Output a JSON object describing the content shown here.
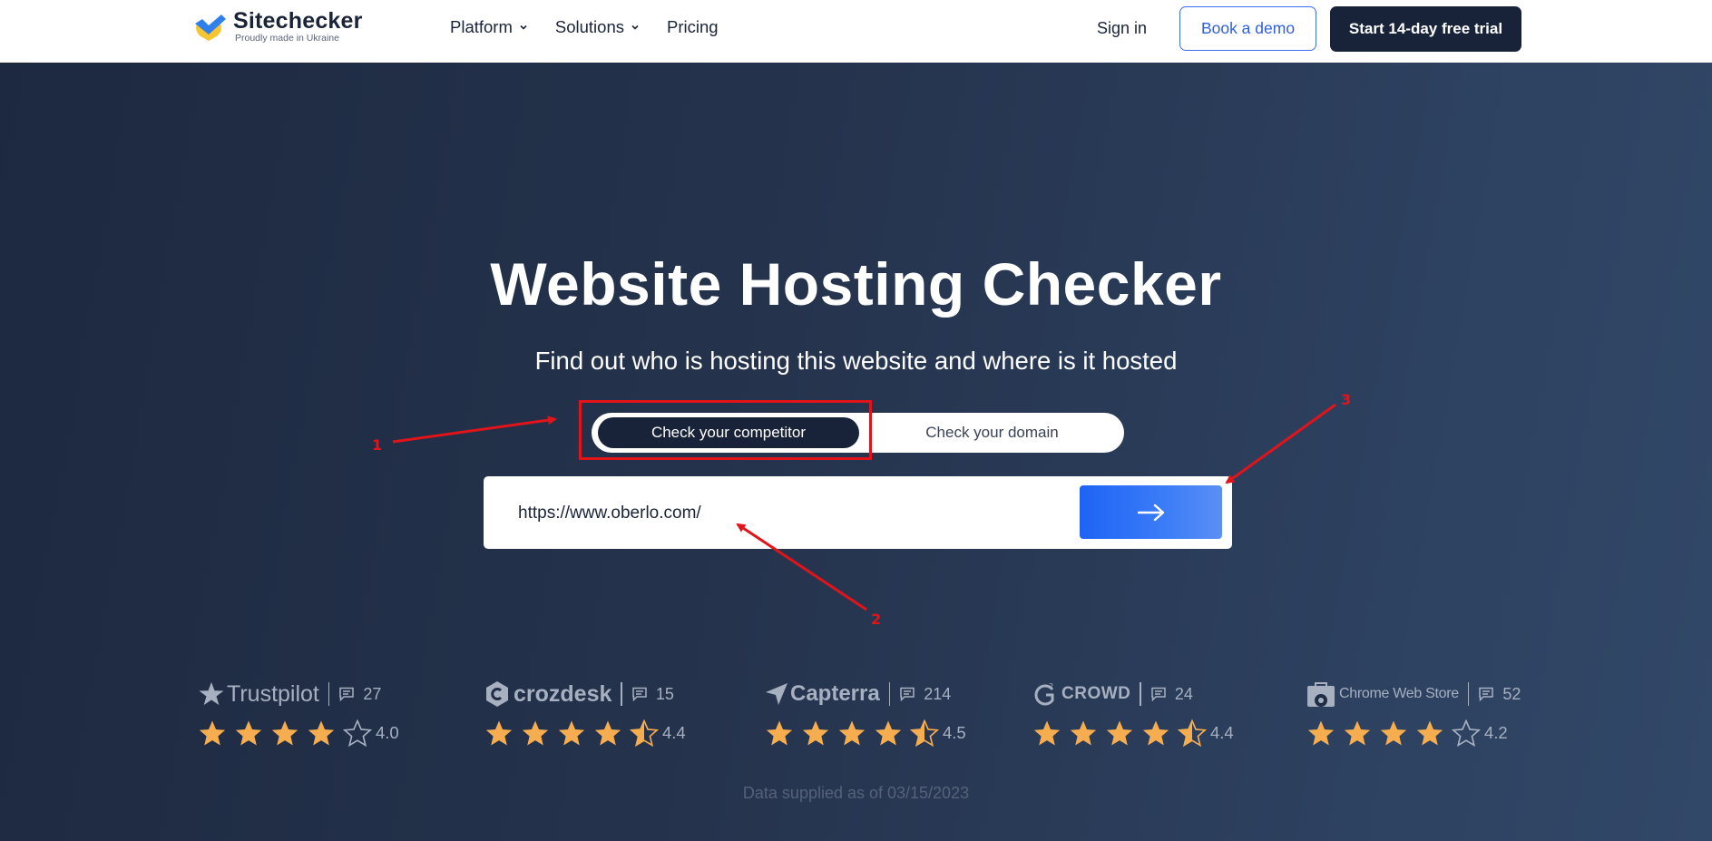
{
  "header": {
    "logo_name": "Sitechecker",
    "logo_tagline": "Proudly made in Ukraine",
    "nav": [
      {
        "label": "Platform",
        "has_dropdown": true
      },
      {
        "label": "Solutions",
        "has_dropdown": true
      },
      {
        "label": "Pricing",
        "has_dropdown": false
      }
    ],
    "sign_in": "Sign in",
    "book_demo": "Book a demo",
    "start_trial": "Start 14-day free trial"
  },
  "hero": {
    "title": "Website Hosting Checker",
    "subtitle": "Find out who is hosting this website and where is it hosted",
    "toggle": {
      "active": "Check your competitor",
      "inactive": "Check your domain"
    },
    "url_value": "https://www.oberlo.com/",
    "submit_icon": "arrow-right-icon"
  },
  "annotations": {
    "n1": "1",
    "n2": "2",
    "n3": "3",
    "color": "#e0141a"
  },
  "reviews": [
    {
      "source": "Trustpilot",
      "count": "27",
      "score": "4.0",
      "rating": 4.0
    },
    {
      "source": "crozdesk",
      "count": "15",
      "score": "4.4",
      "rating": 4.4
    },
    {
      "source": "Capterra",
      "count": "214",
      "score": "4.5",
      "rating": 4.5
    },
    {
      "source": "CROWD",
      "count": "24",
      "score": "4.4",
      "rating": 4.4
    },
    {
      "source": "Chrome Web Store",
      "count": "52",
      "score": "4.2",
      "rating": 4.2
    }
  ],
  "footnote": "Data supplied as of 03/15/2023",
  "colors": {
    "navy": "#18233a",
    "accent_blue": "#1f63f5",
    "star": "#f6ad4f",
    "muted": "#a7b0c0"
  }
}
